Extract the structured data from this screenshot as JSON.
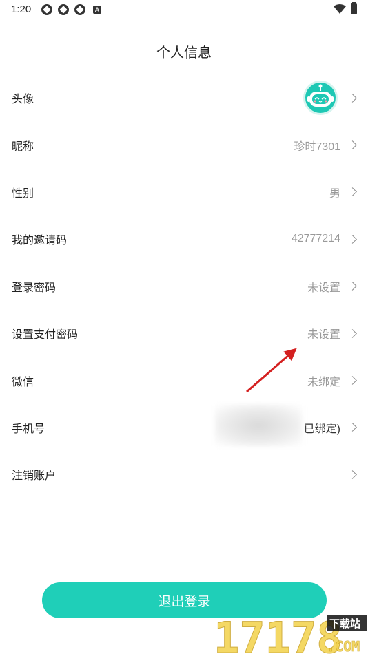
{
  "status_bar": {
    "time": "1:20",
    "notification_icons": [
      "app-icon",
      "app-icon",
      "app-icon",
      "a-icon"
    ],
    "a_badge": "A"
  },
  "header": {
    "title": "个人信息"
  },
  "rows": [
    {
      "label": "头像",
      "value": "",
      "type": "avatar"
    },
    {
      "label": "昵称",
      "value": "珍时7301"
    },
    {
      "label": "性别",
      "value": "男"
    },
    {
      "label": "我的邀请码",
      "value": "42777214"
    },
    {
      "label": "登录密码",
      "value": "未设置"
    },
    {
      "label": "设置支付密码",
      "value": "未设置"
    },
    {
      "label": "微信",
      "value": "未绑定"
    },
    {
      "label": "手机号",
      "value": "已绑定)"
    },
    {
      "label": "注销账户",
      "value": ""
    }
  ],
  "logout_label": "退出登录",
  "watermark": {
    "digits": "17178",
    "tag": "下载站",
    "suffix": ".COM"
  },
  "colors": {
    "accent": "#1fcfb8",
    "arrow": "#d42020",
    "text": "#222222",
    "muted": "#999999"
  }
}
